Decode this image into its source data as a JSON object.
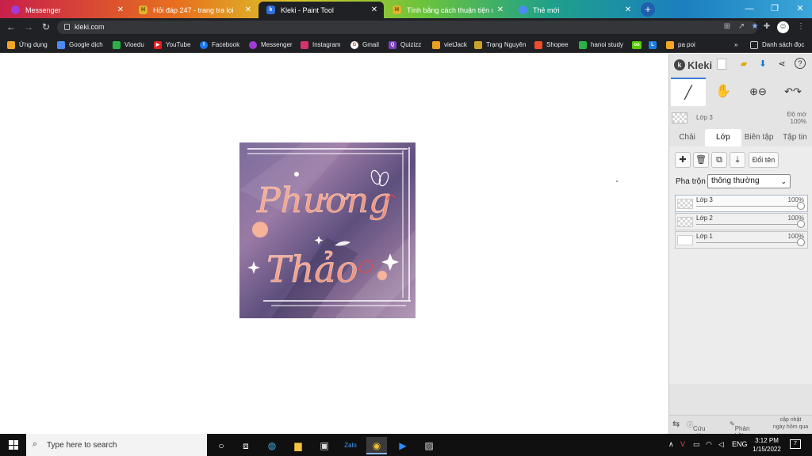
{
  "tabs": [
    {
      "label": "Messenger",
      "favicon_color": "#a33ad8",
      "favicon": "messenger-icon"
    },
    {
      "label": "Hỏi đáp 247 - trang tra loi",
      "favicon_color": "#e0b32a",
      "favicon": "H"
    },
    {
      "label": "Kleki - Paint Tool",
      "favicon_color": "#2f6fdc",
      "favicon": "kleki-icon"
    },
    {
      "label": "Tính bằng cách thuận tiện nhất:",
      "favicon_color": "#e0b32a",
      "favicon": "H"
    },
    {
      "label": "Thẻ mới",
      "favicon_color": "#4c8bf5",
      "favicon": "chrome-icon"
    }
  ],
  "address": {
    "url": "kleki.com"
  },
  "bookmarks": [
    {
      "label": "Ứng dụng",
      "color": "#f5a623"
    },
    {
      "label": "Google dịch",
      "color": "#4c8bf5"
    },
    {
      "label": "Vioedu",
      "color": "#2bb04a"
    },
    {
      "label": "YouTube",
      "color": "#e02020"
    },
    {
      "label": "Facebook",
      "color": "#1877f2"
    },
    {
      "label": "Messenger",
      "color": "#a33ad8"
    },
    {
      "label": "Instagram",
      "color": "#d6336c"
    },
    {
      "label": "Gmail",
      "color": "#ffffff"
    },
    {
      "label": "Quizizz",
      "color": "#7b3fbf"
    },
    {
      "label": "vietJack",
      "color": "#e8a020"
    },
    {
      "label": "Trạng Nguyên",
      "color": "#c9a227"
    },
    {
      "label": "Shopee",
      "color": "#ee4d2d"
    },
    {
      "label": "hanoi study",
      "color": "#2bb04a"
    },
    {
      "label": "pa poi",
      "color": "#f5a623"
    }
  ],
  "bookmarks_more": "»",
  "reading_list": "Danh sách đọc",
  "artwork": {
    "line1": "Phương",
    "line2": "Thảo"
  },
  "panel": {
    "logo": "Kleki",
    "current_layer": "Lớp 3",
    "opacity_label": "Độ mờ",
    "opacity_value": "100%",
    "tabs": [
      "Chải",
      "Lớp",
      "Biên tập",
      "Tập tin"
    ],
    "rename_label": "Đổi tên",
    "blend_label": "Pha trộn",
    "blend_value": "thông thường",
    "layers": [
      {
        "name": "Lớp 3",
        "opacity": "100%"
      },
      {
        "name": "Lớp 2",
        "opacity": "100%"
      },
      {
        "name": "Lớp 1",
        "opacity": "100%"
      }
    ],
    "footer": {
      "help": "Cứu giúp",
      "feedback": "Phản hồi",
      "update": "cập nhật\nngày hôm qua"
    }
  },
  "taskbar": {
    "search_placeholder": "Type here to search",
    "language": "ENG",
    "time": "3:12 PM",
    "date": "1/15/2022",
    "notification_count": "7"
  }
}
